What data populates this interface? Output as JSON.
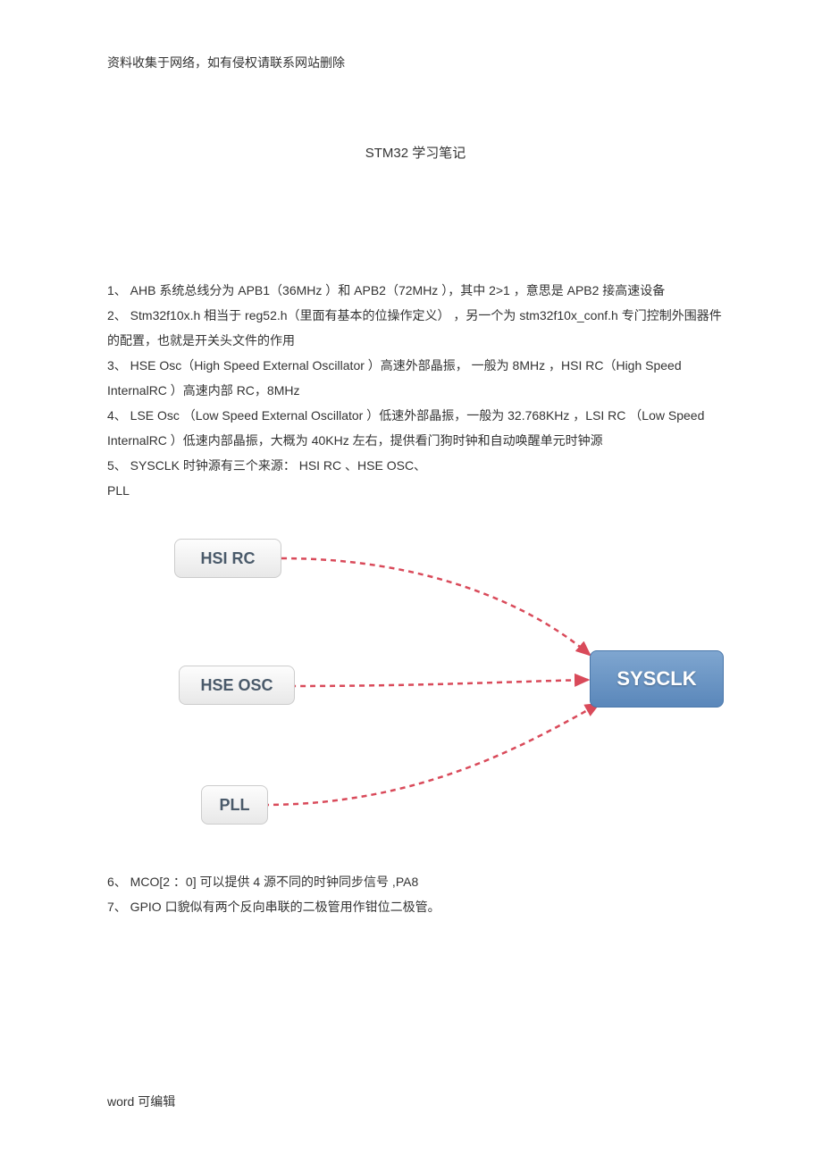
{
  "header": {
    "disclaimer": "资料收集于网络，如有侵权请联系网站删除"
  },
  "title": "STM32 学习笔记",
  "paragraphs": {
    "p1": "1、 AHB 系统总线分为  APB1（36MHz ）和 APB2（72MHz ），其中  2>1 ，意思是  APB2 接高速设备",
    "p2": "2、 Stm32f10x.h  相当于  reg52.h（里面有基本的位操作定义）  ，另一个为  stm32f10x_conf.h 专门控制外围器件的配置，也就是开关头文件的作用",
    "p3": "3、 HSE Osc（High Speed External Oscillator  ）高速外部晶振，  一般为  8MHz ，HSI RC（High Speed InternalRC  ）高速内部  RC，8MHz",
    "p4": "4、 LSE Osc （Low Speed External Oscillator  ）低速外部晶振，一般为   32.768KHz ，LSI RC （Low Speed InternalRC  ）低速内部晶振，大概为   40KHz 左右，提供看门狗时钟和自动唤醒单元时钟源",
    "p5": "5、 SYSCLK 时钟源有三个来源：  HSI RC 、HSE OSC、",
    "p5b": "PLL",
    "p6": "6、 MCO[2 ：0] 可以提供  4 源不同的时钟同步信号   ,PA8",
    "p7": "7、 GPIO  口貌似有两个反向串联的二极管用作钳位二极管。"
  },
  "diagram": {
    "nodes": {
      "hsi": "HSI RC",
      "hse": "HSE OSC",
      "pll": "PLL",
      "sysclk": "SYSCLK"
    }
  },
  "footer": {
    "note": "word  可编辑"
  }
}
